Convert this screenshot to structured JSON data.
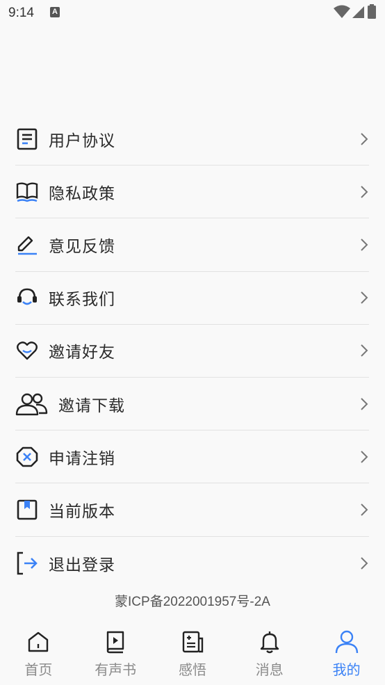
{
  "status": {
    "time": "9:14",
    "notification_glyph": "A"
  },
  "menu": {
    "items": [
      {
        "label": "用户协议",
        "icon": "document-icon"
      },
      {
        "label": "隐私政策",
        "icon": "book-icon"
      },
      {
        "label": "意见反馈",
        "icon": "pencil-icon"
      },
      {
        "label": "联系我们",
        "icon": "headset-icon"
      },
      {
        "label": "邀请好友",
        "icon": "heart-icon"
      },
      {
        "label": "邀请下载",
        "icon": "users-icon"
      },
      {
        "label": "申请注销",
        "icon": "cancel-icon"
      },
      {
        "label": "当前版本",
        "icon": "bookmark-icon"
      },
      {
        "label": "退出登录",
        "icon": "logout-icon"
      }
    ]
  },
  "footer": {
    "icp": "蒙ICP备2022001957号-2A"
  },
  "tabbar": {
    "tabs": [
      {
        "label": "首页",
        "icon": "home-icon"
      },
      {
        "label": "有声书",
        "icon": "audiobook-icon"
      },
      {
        "label": "感悟",
        "icon": "notes-icon"
      },
      {
        "label": "消息",
        "icon": "bell-icon"
      },
      {
        "label": "我的",
        "icon": "person-icon",
        "active": true
      }
    ]
  },
  "colors": {
    "accent": "#3b82f6",
    "text": "#2a2a2a",
    "muted": "#8a8a8a"
  }
}
